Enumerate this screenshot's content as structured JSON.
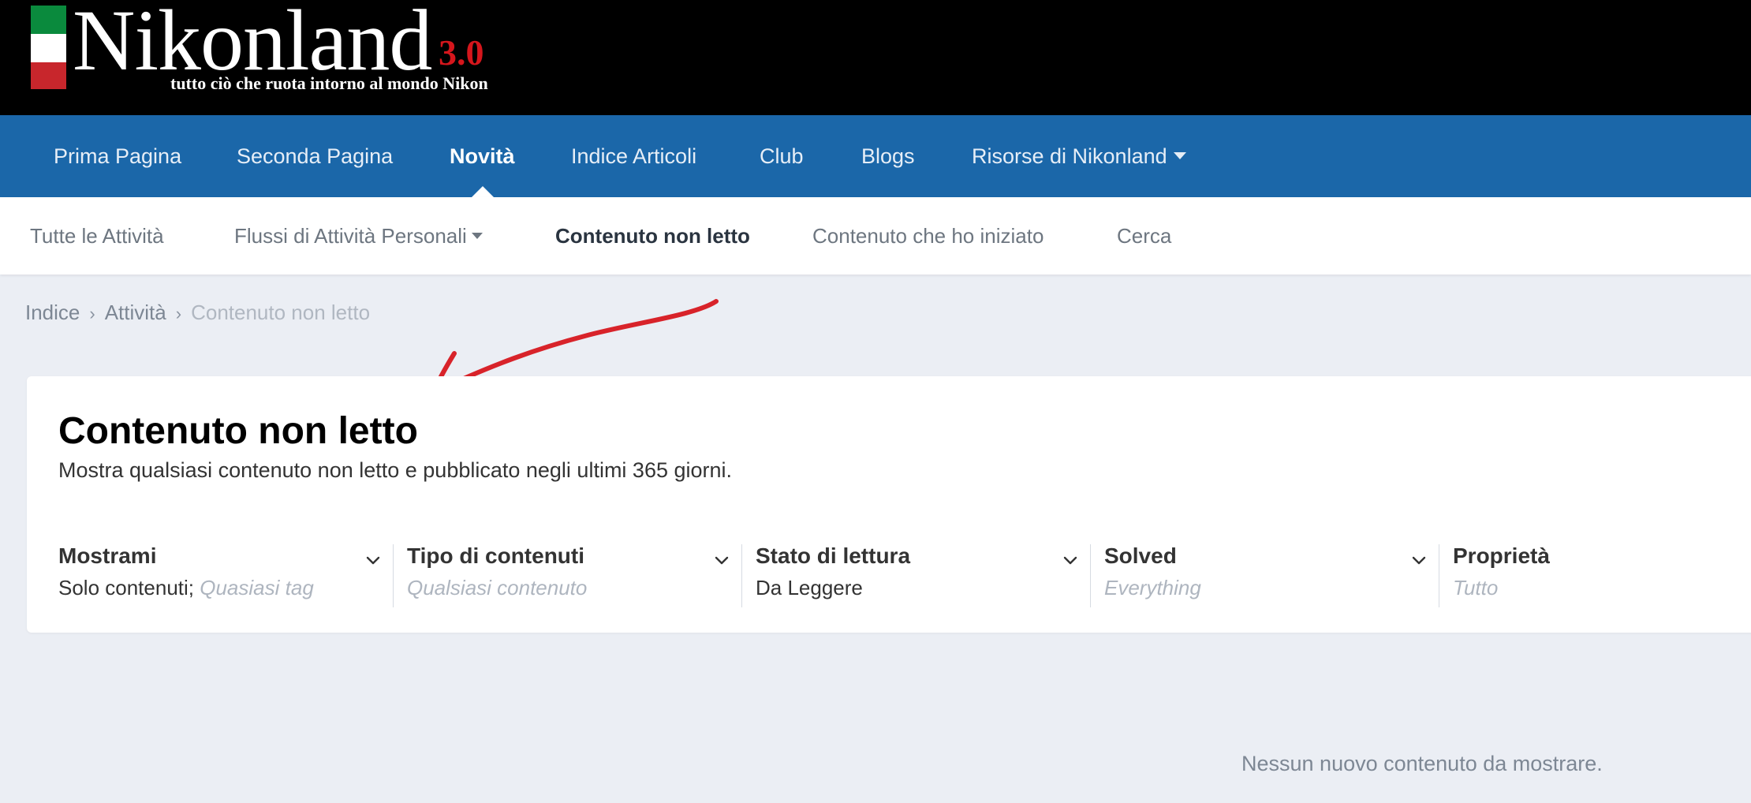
{
  "logo": {
    "name": "Nikonland",
    "version": "3.0",
    "tagline": "tutto ciò che ruota intorno al mondo Nikon",
    "flag_colors": [
      "#0a8a3d",
      "#ffffff",
      "#c8262c"
    ]
  },
  "primary_nav": {
    "items": [
      {
        "label": "Prima Pagina"
      },
      {
        "label": "Seconda Pagina"
      },
      {
        "label": "Novità",
        "active": true
      },
      {
        "label": "Indice Articoli"
      },
      {
        "label": "Club"
      },
      {
        "label": "Blogs"
      },
      {
        "label": "Risorse di Nikonland",
        "dropdown": true
      }
    ]
  },
  "secondary_nav": {
    "items": [
      {
        "label": "Tutte le Attività"
      },
      {
        "label": "Flussi di Attività Personali",
        "dropdown": true
      },
      {
        "label": "Contenuto non letto",
        "active": true
      },
      {
        "label": "Contenuto che ho iniziato"
      },
      {
        "label": "Cerca"
      }
    ]
  },
  "breadcrumb": [
    "Indice",
    "Attività",
    "Contenuto non letto"
  ],
  "page": {
    "title": "Contenuto non letto",
    "description": "Mostra qualsiasi contenuto non letto e pubblicato negli ultimi 365 giorni."
  },
  "filters": [
    {
      "label": "Mostrami",
      "value": "Solo contenuti;",
      "placeholder": "Quasiasi tag"
    },
    {
      "label": "Tipo di contenuti",
      "value": "",
      "placeholder": "Qualsiasi contenuto"
    },
    {
      "label": "Stato di lettura",
      "value": "Da Leggere",
      "placeholder": ""
    },
    {
      "label": "Solved",
      "value": "",
      "placeholder": "Everything"
    },
    {
      "label": "Proprietà",
      "value": "",
      "placeholder": "Tutto"
    }
  ],
  "empty_message": "Nessun nuovo contenuto da mostrare.",
  "colors": {
    "header_bg": "#000000",
    "primary_nav_bg": "#1b67a9",
    "page_bg": "#ebeef4",
    "annotation_arrow": "#d8232a"
  }
}
